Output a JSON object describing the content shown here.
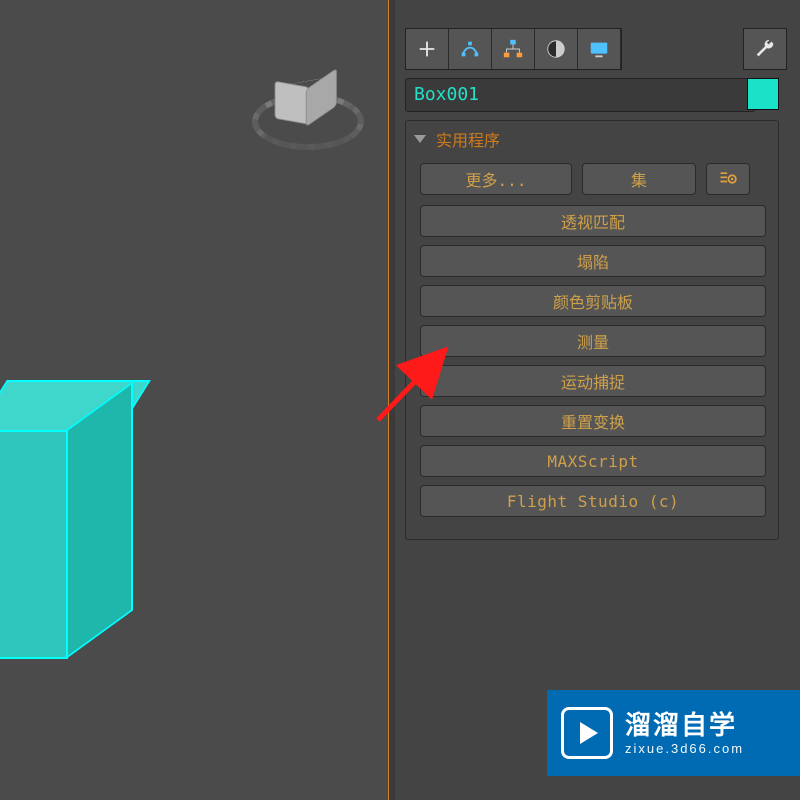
{
  "object_name": "Box001",
  "color_swatch": "#19e2c8",
  "rollout": {
    "title": "实用程序",
    "more": "更多...",
    "set": "集",
    "items": [
      "透视匹配",
      "塌陷",
      "颜色剪贴板",
      "测量",
      "运动捕捉",
      "重置变换",
      "MAXScript",
      "Flight Studio (c)"
    ]
  },
  "watermark": {
    "title": "溜溜自学",
    "url": "zixue.3d66.com"
  },
  "tabs": {
    "create": "create-icon",
    "modify": "modify-icon",
    "hierarchy": "hierarchy-icon",
    "motion": "motion-icon",
    "display": "display-icon",
    "utilities": "utilities-icon"
  }
}
